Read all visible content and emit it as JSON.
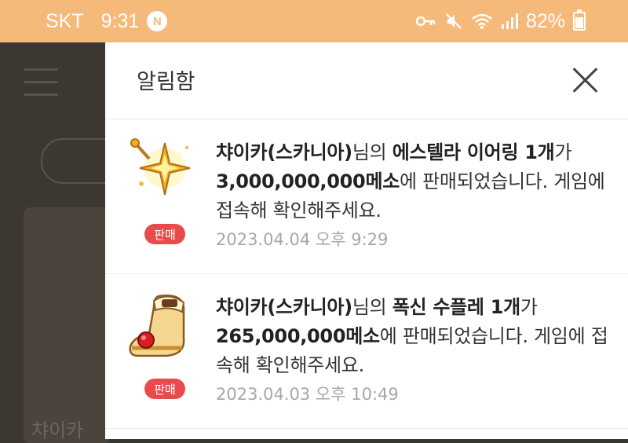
{
  "status_bar": {
    "carrier": "SKT",
    "time": "9:31",
    "app_badge": "N",
    "battery": "82%"
  },
  "background": {
    "partial_text": "챠이카"
  },
  "panel": {
    "title": "알림함"
  },
  "notifications": [
    {
      "seller": "챠이카(스카니아)",
      "seller_suffix": "님의 ",
      "item": "에스텔라 이어링 1개",
      "item_suffix": "가 ",
      "price": "3,000,000,000메소",
      "message_tail": "에 판매되었습니다. 게임에 접속해 확인해주세요.",
      "badge": "판매",
      "date": "2023.04.04 오후 9:29"
    },
    {
      "seller": "챠이카(스카니아)",
      "seller_suffix": "님의 ",
      "item": "폭신 수플레 1개",
      "item_suffix": "가 ",
      "price": "265,000,000메소",
      "message_tail": "에 판매되었습니다. 게임에 접속해 확인해주세요.",
      "badge": "판매",
      "date": "2023.04.03 오후 10:49"
    }
  ],
  "colors": {
    "status_bar": "#f5b97a",
    "badge": "#e84b4b",
    "date": "#a7a7a7"
  }
}
